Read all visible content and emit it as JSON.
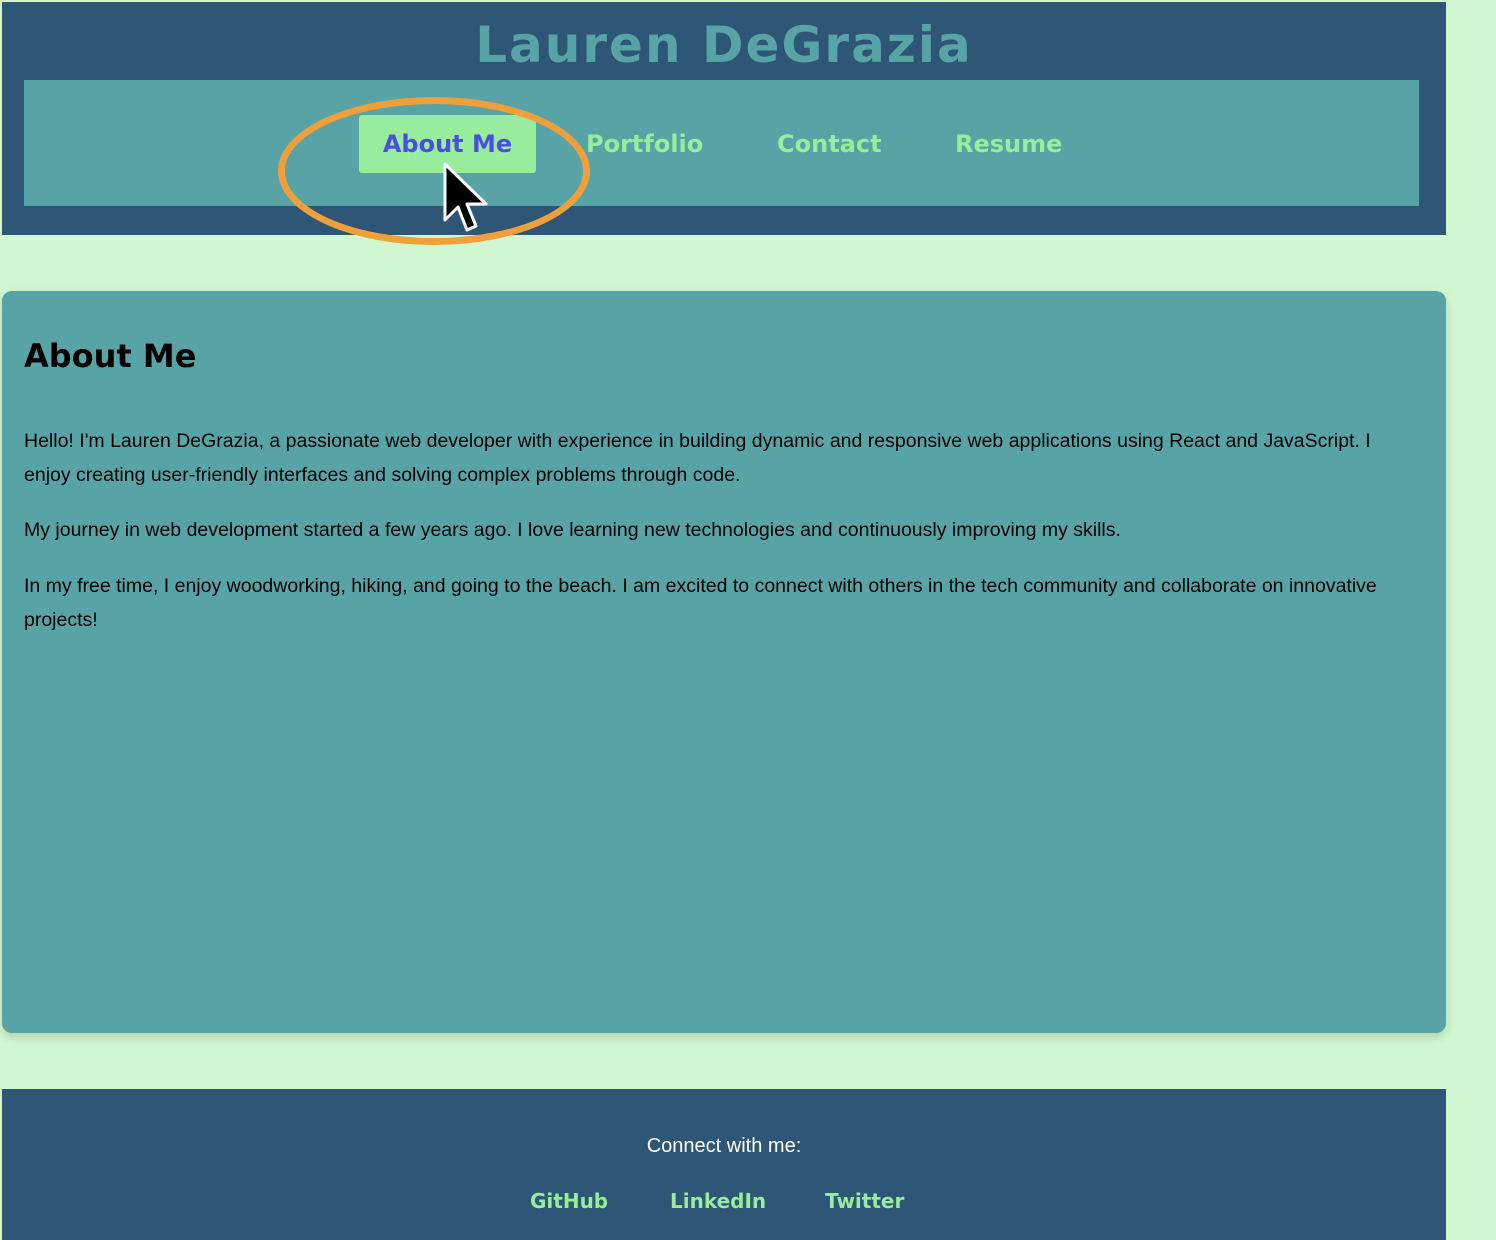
{
  "header": {
    "title": "Lauren DeGrazia",
    "nav": [
      {
        "label": "About Me",
        "active": true
      },
      {
        "label": "Portfolio"
      },
      {
        "label": "Contact"
      },
      {
        "label": "Resume"
      }
    ]
  },
  "main": {
    "heading": "About Me",
    "paragraphs": [
      "Hello! I'm Lauren DeGrazia, a passionate web developer with experience in building dynamic and responsive web applications using React and JavaScript. I enjoy creating user-friendly interfaces and solving complex problems through code.",
      "My journey in web development started a few years ago. I love learning new technologies and continuously improving my skills.",
      "In my free time, I enjoy woodworking, hiking, and going to the beach. I am excited to connect with others in the tech community and collaborate on innovative projects!"
    ]
  },
  "footer": {
    "connect_text": "Connect with me:",
    "links": [
      {
        "label": "GitHub"
      },
      {
        "label": "LinkedIn"
      },
      {
        "label": "Twitter"
      }
    ]
  },
  "colors": {
    "page_background": "#d0f7d0",
    "header_background": "#2e5676",
    "teal": "#58a3a6",
    "accent_green": "#98ec9d",
    "active_text": "#4b4fe0",
    "highlight_ring": "#f0a03b"
  },
  "icons": {
    "cursor": "mouse-pointer-icon"
  }
}
